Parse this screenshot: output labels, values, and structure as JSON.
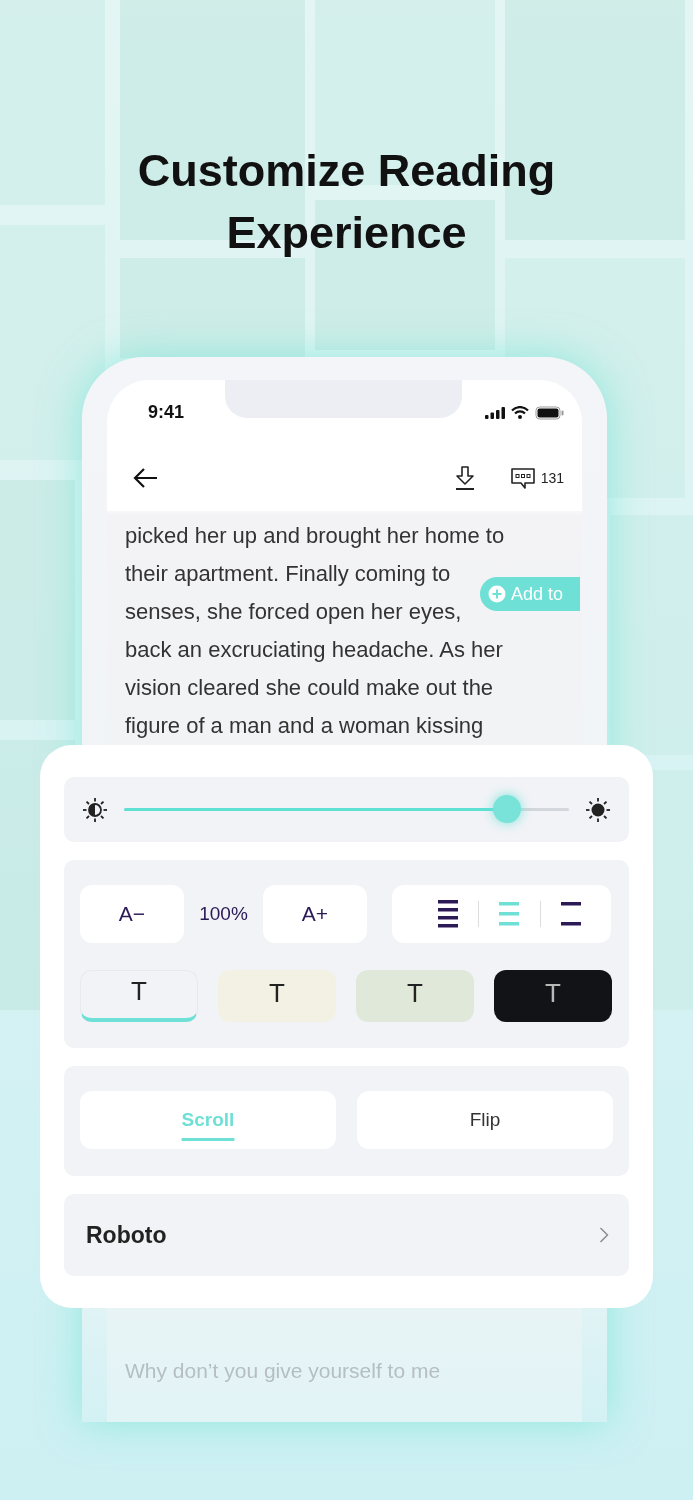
{
  "headline": "Customize Reading Experience",
  "status_bar": {
    "time": "9:41"
  },
  "toolbar": {
    "comment_count": "131"
  },
  "reading_text": [
    "picked her up and brought her home to",
    "their apartment. Finally coming to",
    "senses, she forced open her eyes,",
    "back an excruciating headache. As her",
    "vision cleared she could make out the",
    "figure of a man and a woman kissing"
  ],
  "selection_popup": {
    "label": "Add to"
  },
  "settings_panel": {
    "brightness": {
      "level": 0.86
    },
    "font_size": {
      "decrease": "A−",
      "value": "100%",
      "increase": "A+"
    },
    "line_spacing": [
      {
        "kind": "compact",
        "selected": false
      },
      {
        "kind": "normal",
        "selected": true
      },
      {
        "kind": "wide",
        "selected": false
      }
    ],
    "themes": [
      {
        "label": "T",
        "color": "#f2f3f7",
        "selected": true
      },
      {
        "label": "T",
        "color": "#f3f1e3",
        "selected": false
      },
      {
        "label": "T",
        "color": "#e0e8da",
        "selected": false
      },
      {
        "label": "T",
        "color": "#121316",
        "selected": false
      }
    ],
    "page_mode": [
      {
        "label": "Scroll",
        "selected": true
      },
      {
        "label": "Flip",
        "selected": false
      }
    ],
    "font": {
      "name": "Roboto"
    }
  },
  "below_text": "Why don’t you give yourself to me"
}
